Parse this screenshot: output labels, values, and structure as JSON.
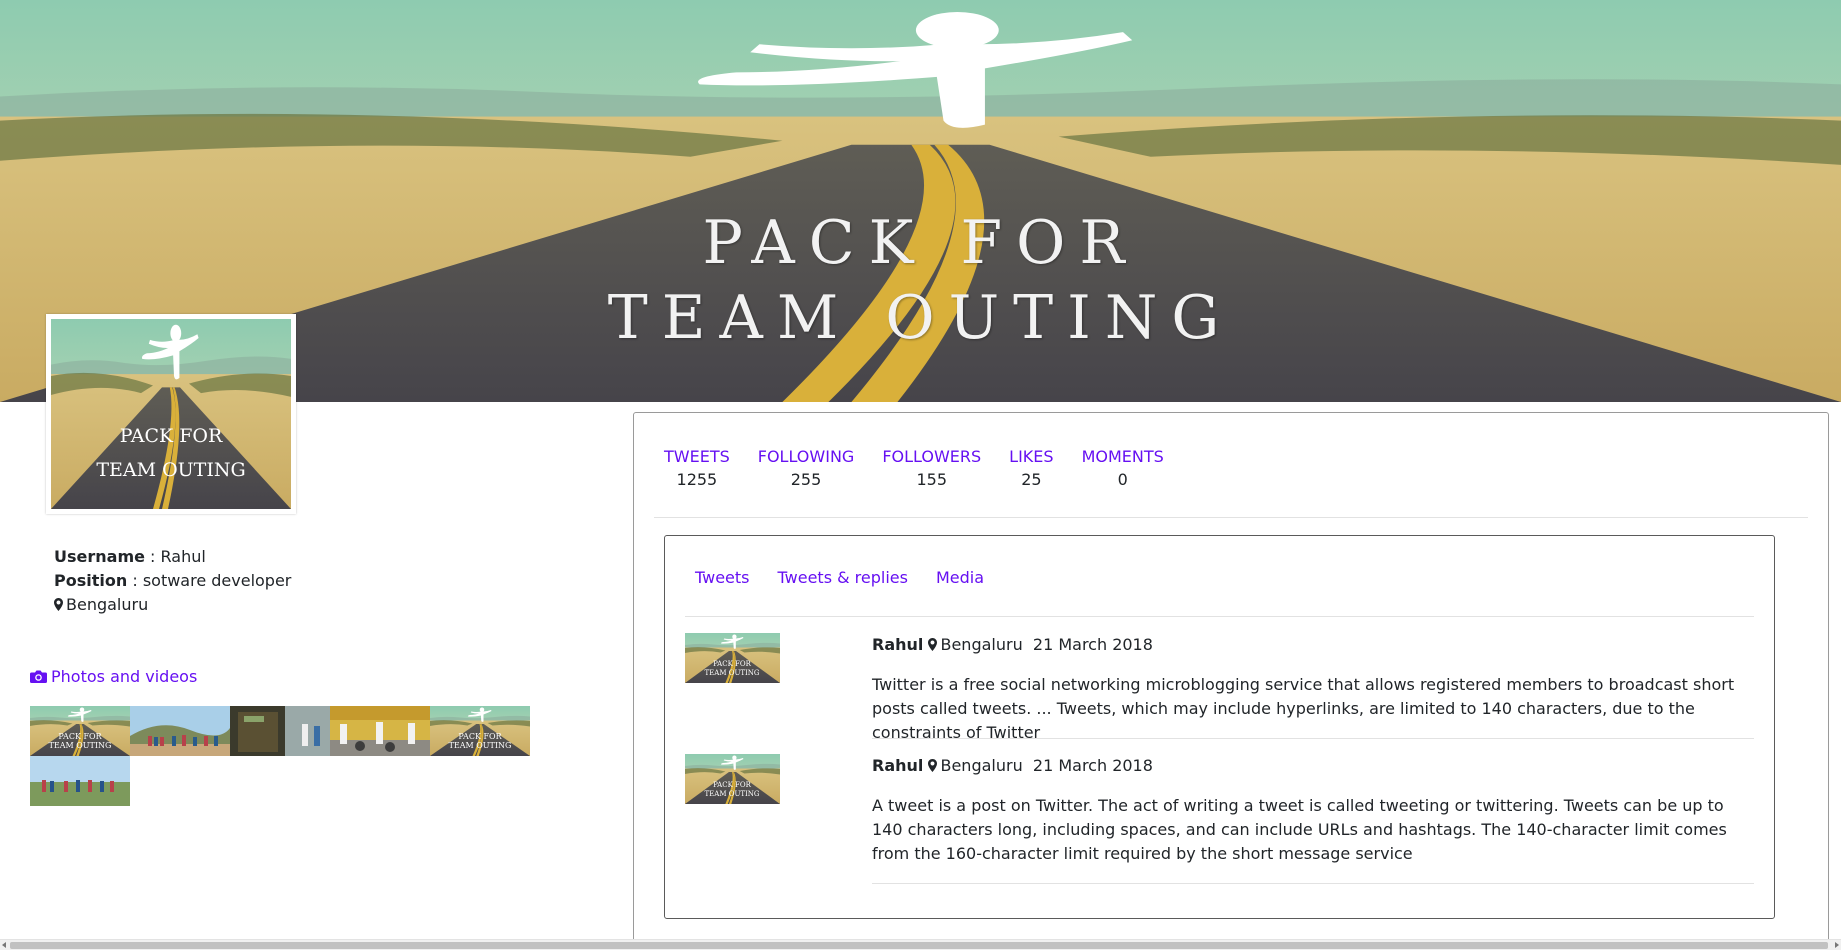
{
  "banner": {
    "line1": "PACK FOR",
    "line2": "TEAM OUTING"
  },
  "avatar": {
    "line1": "PACK FOR",
    "line2": "TEAM OUTING"
  },
  "profile": {
    "username_label": "Username",
    "username_value": " : Rahul",
    "position_label": "Position",
    "position_value": " : sotware developer",
    "location": "Bengaluru"
  },
  "photos": {
    "label": "Photos and videos",
    "thumbnails": [
      "team-outing-poster",
      "group-photo-hill",
      "shop-front",
      "street-scene",
      "team-outing-poster",
      "group-photo-field"
    ]
  },
  "stats": [
    {
      "label": "TWEETS",
      "value": "1255"
    },
    {
      "label": "FOLLOWING",
      "value": "255"
    },
    {
      "label": "FOLLOWERS",
      "value": "155"
    },
    {
      "label": "LIKES",
      "value": "25"
    },
    {
      "label": "MOMENTS",
      "value": "0"
    }
  ],
  "tabs": [
    "Tweets",
    "Tweets & replies",
    "Media"
  ],
  "tweets": [
    {
      "author": "Rahul",
      "location": "Bengaluru",
      "date": "21 March 2018",
      "text": "Twitter is a free social networking microblogging service that allows registered members to broadcast short posts called tweets. ... Tweets, which may include hyperlinks, are limited to 140 characters, due to the constraints of Twitter"
    },
    {
      "author": "Rahul",
      "location": "Bengaluru",
      "date": "21 March 2018",
      "text": "A tweet is a post on Twitter. The act of writing a tweet is called tweeting or twittering. Tweets can be up to 140 characters long, including spaces, and can include URLs and hashtags. The 140-character limit comes from the 160-character limit required by the short message service"
    }
  ],
  "colors": {
    "accent": "#6610f2",
    "text": "#212529",
    "border": "#5a5a5a"
  },
  "icons": {
    "location": "map-marker-icon",
    "photos": "camera-icon"
  }
}
